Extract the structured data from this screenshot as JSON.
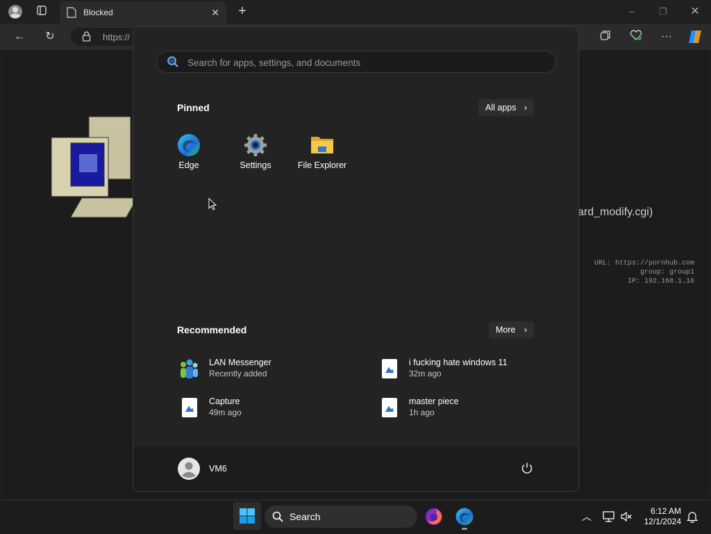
{
  "browser": {
    "tab_title": "Blocked",
    "url_text": "https://",
    "colors": {
      "chrome_bg": "#202020",
      "toolbar_bg": "#2b2b2b",
      "accent": "#0078d4"
    }
  },
  "page": {
    "partial_text": "ard_modify.cgi)",
    "info_lines": [
      "URL: https://pornhub.com",
      "group: group1",
      "IP: 192.168.1.16"
    ]
  },
  "start_menu": {
    "search_placeholder": "Search for apps, settings, and documents",
    "pinned_title": "Pinned",
    "all_apps_label": "All apps",
    "pinned": [
      {
        "label": "Edge",
        "icon": "edge-icon"
      },
      {
        "label": "Settings",
        "icon": "settings-gear-icon"
      },
      {
        "label": "File Explorer",
        "icon": "folder-icon"
      }
    ],
    "recommended_title": "Recommended",
    "more_label": "More",
    "recommended": [
      {
        "name": "LAN Messenger",
        "sub": "Recently added",
        "icon": "lan-messenger-icon"
      },
      {
        "name": "i fucking hate windows 11",
        "sub": "32m ago",
        "icon": "image-file-icon"
      },
      {
        "name": "Capture",
        "sub": "49m ago",
        "icon": "image-file-icon"
      },
      {
        "name": "master piece",
        "sub": "1h ago",
        "icon": "image-file-icon"
      }
    ],
    "user_name": "VM6"
  },
  "taskbar": {
    "search_label": "Search",
    "time": "6:12 AM",
    "date": "12/1/2024"
  }
}
